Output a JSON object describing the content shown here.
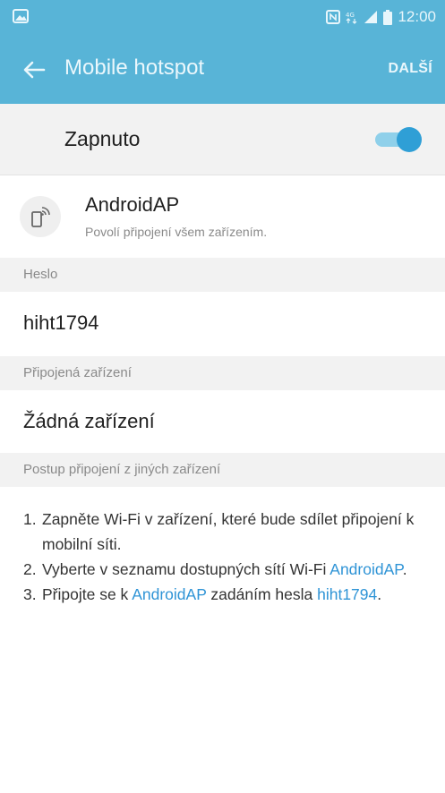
{
  "status_bar": {
    "time": "12:00",
    "icons": [
      "image-notification-icon",
      "nfc-icon",
      "lte-icon",
      "signal-icon",
      "battery-icon"
    ],
    "color": "#58b4d7"
  },
  "app_bar": {
    "title": "Mobile hotspot",
    "more_label": "DALŠÍ",
    "color": "#58b4d7"
  },
  "hotspot_switch": {
    "label": "Zapnuto",
    "state": "on",
    "accent": "#2f9fd6"
  },
  "network": {
    "name": "AndroidAP",
    "description": "Povolí připojení všem zařízením."
  },
  "password_section": {
    "header": "Heslo",
    "value": "hiht1794"
  },
  "connected_section": {
    "header": "Připojená zařízení",
    "value": "Žádná zařízení"
  },
  "instructions_section": {
    "header": "Postup připojení z jiných zařízení",
    "steps": [
      {
        "num": "1.",
        "text": "Zapněte Wi-Fi v zařízení, které bude sdílet připojení k mobilní síti."
      },
      {
        "num": "2.",
        "text_before": "Vyberte v seznamu dostupných sítí Wi-Fi ",
        "link": "AndroidAP",
        "text_after": "."
      },
      {
        "num": "3.",
        "text_before": "Připojte se k ",
        "link": "AndroidAP",
        "text_middle": " zadáním hesla ",
        "link2": "hiht1794",
        "text_after": "."
      }
    ],
    "link_color": "#2f94d6"
  }
}
